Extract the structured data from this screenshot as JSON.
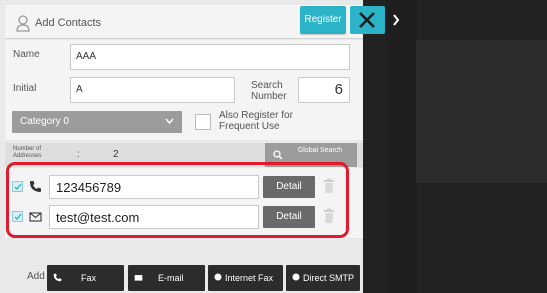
{
  "header": {
    "title": "Add Contacts",
    "register_label": "Register"
  },
  "form": {
    "name_label": "Name",
    "name_value": "AAA",
    "initial_label": "Initial",
    "initial_value": "A",
    "search_number_label": "Search\nNumber",
    "search_number_value": "6",
    "category_value": "Category 0",
    "frequent_label": "Also Register for Frequent Use"
  },
  "addresses": {
    "count_label": "Number of Addresses",
    "colon": ":",
    "count_value": "2",
    "global_search_label": "Global Search",
    "items": [
      {
        "type": "phone",
        "icon": "phone-icon",
        "value": "123456789",
        "detail_label": "Detail"
      },
      {
        "type": "email",
        "icon": "mail-icon",
        "value": "test@test.com",
        "detail_label": "Detail"
      }
    ]
  },
  "footer": {
    "add_label": "Add",
    "buttons": [
      {
        "label": "Fax",
        "icon": "phone-icon"
      },
      {
        "label": "E-mail",
        "icon": "mail-icon"
      },
      {
        "label": "Internet Fax",
        "icon": "dot-icon"
      },
      {
        "label": "Direct SMTP",
        "icon": "dot-icon"
      }
    ]
  },
  "colors": {
    "accent": "#2bb3c7",
    "highlight": "#e3182d"
  }
}
